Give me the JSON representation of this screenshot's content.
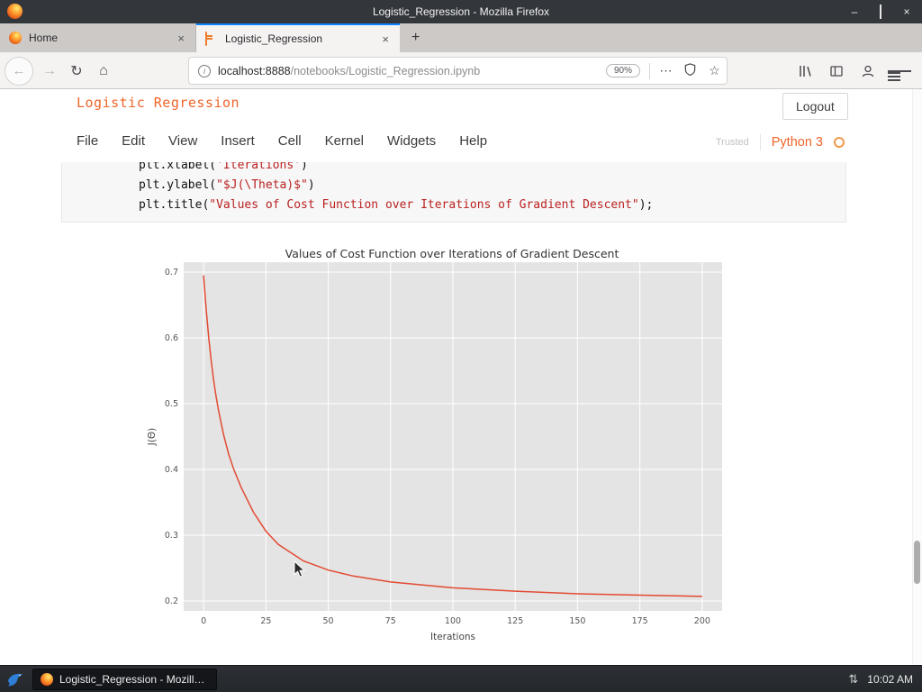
{
  "window": {
    "title": "Logistic_Regression - Mozilla Firefox"
  },
  "icons": {
    "back": "←",
    "forward": "→",
    "reload": "↻",
    "home": "⌂",
    "dots": "⋯",
    "star": "☆",
    "close": "×",
    "minimize": "–",
    "new_tab": "+",
    "network": "⇅",
    "info": "i"
  },
  "tabs": [
    {
      "label": "Home"
    },
    {
      "label": "Logistic_Regression"
    }
  ],
  "urlbar": {
    "host": "localhost:8888",
    "path": "/notebooks/Logistic_Regression.ipynb",
    "zoom": "90%"
  },
  "notebook": {
    "title": "Logistic Regression",
    "logout_label": "Logout",
    "menu": [
      "File",
      "Edit",
      "View",
      "Insert",
      "Cell",
      "Kernel",
      "Widgets",
      "Help"
    ],
    "trusted_label": "Trusted",
    "kernel_name": "Python 3",
    "code": [
      {
        "pre": "plt.xlabel(",
        "str": "'Iterations'",
        "post": ")"
      },
      {
        "pre": "plt.ylabel(",
        "str": "\"$J(\\Theta)$\"",
        "post": ")"
      },
      {
        "pre": "plt.title(",
        "str": "\"Values of Cost Function over Iterations of Gradient Descent\"",
        "post": ");"
      }
    ]
  },
  "chart_data": {
    "type": "line",
    "title": "Values of Cost Function over Iterations of Gradient Descent",
    "xlabel": "Iterations",
    "ylabel": "J(Θ)",
    "x": [
      0,
      1,
      2,
      3,
      4,
      5,
      6,
      8,
      10,
      12,
      15,
      20,
      25,
      30,
      40,
      50,
      60,
      75,
      100,
      125,
      150,
      175,
      200
    ],
    "y": [
      0.695,
      0.645,
      0.602,
      0.566,
      0.536,
      0.511,
      0.489,
      0.453,
      0.424,
      0.401,
      0.373,
      0.335,
      0.306,
      0.286,
      0.261,
      0.247,
      0.238,
      0.229,
      0.22,
      0.215,
      0.211,
      0.209,
      0.207
    ],
    "xlim": [
      -8,
      208
    ],
    "ylim": [
      0.185,
      0.715
    ],
    "xticks": [
      0,
      25,
      50,
      75,
      100,
      125,
      150,
      175,
      200
    ],
    "yticks": [
      0.2,
      0.3,
      0.4,
      0.5,
      0.6,
      0.7
    ],
    "line_color": "#e24a33",
    "bg_color": "#e4e4e4",
    "grid": true,
    "legend_position": "none"
  },
  "taskbar": {
    "task_label": "Logistic_Regression - Mozilla...",
    "time": "10:02 AM"
  }
}
